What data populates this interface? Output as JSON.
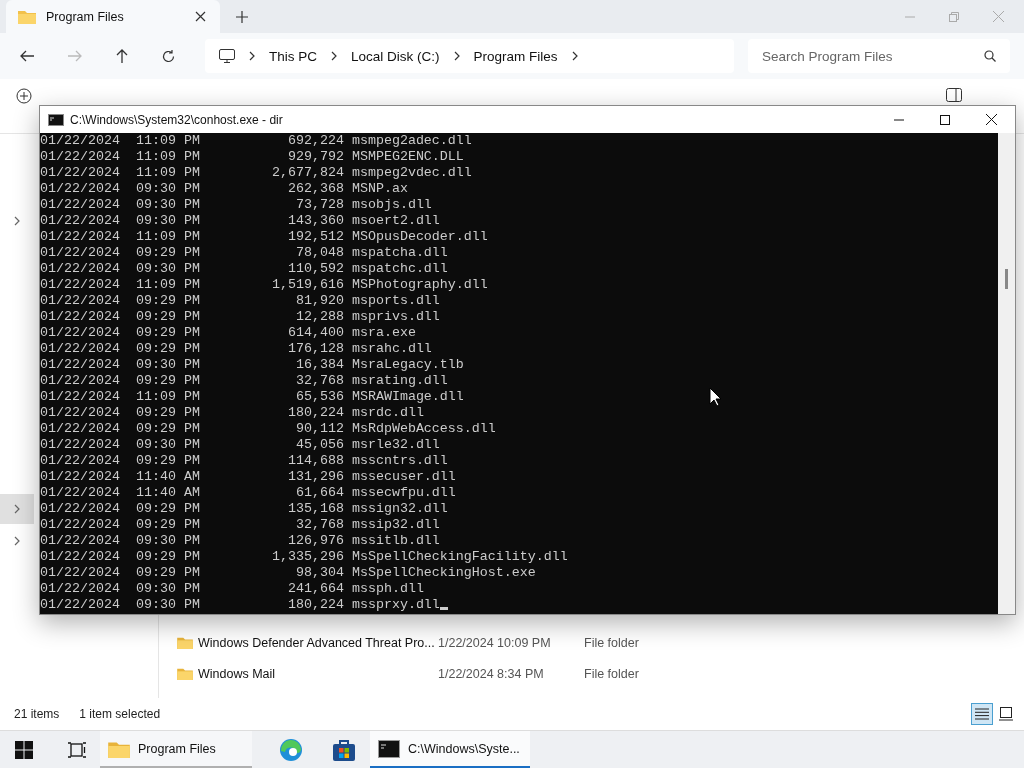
{
  "explorer": {
    "tab": {
      "title": "Program Files"
    },
    "breadcrumb": [
      "This PC",
      "Local Disk (C:)",
      "Program Files"
    ],
    "search": {
      "placeholder": "Search Program Files"
    },
    "files": [
      {
        "name": "Windows Defender Advanced Threat Pro...",
        "modified": "1/22/2024 10:09 PM",
        "type": "File folder"
      },
      {
        "name": "Windows Mail",
        "modified": "1/22/2024 8:34 PM",
        "type": "File folder"
      }
    ],
    "nav_rows": [
      {
        "selected": false
      },
      {
        "selected": true
      },
      {
        "selected": false
      }
    ],
    "status": {
      "count": "21 items",
      "selection": "1 item selected"
    },
    "views": [
      {
        "kind": "details",
        "selected": true
      },
      {
        "kind": "tiles",
        "selected": false
      }
    ]
  },
  "console": {
    "title": "C:\\Windows\\System32\\conhost.exe - dir",
    "lines": [
      {
        "date": "01/22/2024",
        "time": "11:09 PM",
        "size": "692,224",
        "name": "msmpeg2adec.dll"
      },
      {
        "date": "01/22/2024",
        "time": "11:09 PM",
        "size": "929,792",
        "name": "MSMPEG2ENC.DLL"
      },
      {
        "date": "01/22/2024",
        "time": "11:09 PM",
        "size": "2,677,824",
        "name": "msmpeg2vdec.dll"
      },
      {
        "date": "01/22/2024",
        "time": "09:30 PM",
        "size": "262,368",
        "name": "MSNP.ax"
      },
      {
        "date": "01/22/2024",
        "time": "09:30 PM",
        "size": "73,728",
        "name": "msobjs.dll"
      },
      {
        "date": "01/22/2024",
        "time": "09:30 PM",
        "size": "143,360",
        "name": "msoert2.dll"
      },
      {
        "date": "01/22/2024",
        "time": "11:09 PM",
        "size": "192,512",
        "name": "MSOpusDecoder.dll"
      },
      {
        "date": "01/22/2024",
        "time": "09:29 PM",
        "size": "78,048",
        "name": "mspatcha.dll"
      },
      {
        "date": "01/22/2024",
        "time": "09:30 PM",
        "size": "110,592",
        "name": "mspatchc.dll"
      },
      {
        "date": "01/22/2024",
        "time": "11:09 PM",
        "size": "1,519,616",
        "name": "MSPhotography.dll"
      },
      {
        "date": "01/22/2024",
        "time": "09:29 PM",
        "size": "81,920",
        "name": "msports.dll"
      },
      {
        "date": "01/22/2024",
        "time": "09:29 PM",
        "size": "12,288",
        "name": "msprivs.dll"
      },
      {
        "date": "01/22/2024",
        "time": "09:29 PM",
        "size": "614,400",
        "name": "msra.exe"
      },
      {
        "date": "01/22/2024",
        "time": "09:29 PM",
        "size": "176,128",
        "name": "msrahc.dll"
      },
      {
        "date": "01/22/2024",
        "time": "09:30 PM",
        "size": "16,384",
        "name": "MsraLegacy.tlb"
      },
      {
        "date": "01/22/2024",
        "time": "09:29 PM",
        "size": "32,768",
        "name": "msrating.dll"
      },
      {
        "date": "01/22/2024",
        "time": "11:09 PM",
        "size": "65,536",
        "name": "MSRAWImage.dll"
      },
      {
        "date": "01/22/2024",
        "time": "09:29 PM",
        "size": "180,224",
        "name": "msrdc.dll"
      },
      {
        "date": "01/22/2024",
        "time": "09:29 PM",
        "size": "90,112",
        "name": "MsRdpWebAccess.dll"
      },
      {
        "date": "01/22/2024",
        "time": "09:30 PM",
        "size": "45,056",
        "name": "msrle32.dll"
      },
      {
        "date": "01/22/2024",
        "time": "09:29 PM",
        "size": "114,688",
        "name": "msscntrs.dll"
      },
      {
        "date": "01/22/2024",
        "time": "11:40 AM",
        "size": "131,296",
        "name": "mssecuser.dll"
      },
      {
        "date": "01/22/2024",
        "time": "11:40 AM",
        "size": "61,664",
        "name": "mssecwfpu.dll"
      },
      {
        "date": "01/22/2024",
        "time": "09:29 PM",
        "size": "135,168",
        "name": "mssign32.dll"
      },
      {
        "date": "01/22/2024",
        "time": "09:29 PM",
        "size": "32,768",
        "name": "mssip32.dll"
      },
      {
        "date": "01/22/2024",
        "time": "09:30 PM",
        "size": "126,976",
        "name": "mssitlb.dll"
      },
      {
        "date": "01/22/2024",
        "time": "09:29 PM",
        "size": "1,335,296",
        "name": "MsSpellCheckingFacility.dll"
      },
      {
        "date": "01/22/2024",
        "time": "09:29 PM",
        "size": "98,304",
        "name": "MsSpellCheckingHost.exe"
      },
      {
        "date": "01/22/2024",
        "time": "09:30 PM",
        "size": "241,664",
        "name": "mssph.dll"
      },
      {
        "date": "01/22/2024",
        "time": "09:30 PM",
        "size": "180,224",
        "name": "mssprxy.dll"
      }
    ]
  },
  "taskbar": {
    "apps": [
      {
        "kind": "start"
      },
      {
        "kind": "taskview"
      },
      {
        "kind": "explorer",
        "label": "Program Files",
        "selected": false
      },
      {
        "kind": "edge"
      },
      {
        "kind": "store"
      },
      {
        "kind": "console",
        "label": "C:\\Windows\\Syste...",
        "selected": true
      }
    ]
  }
}
